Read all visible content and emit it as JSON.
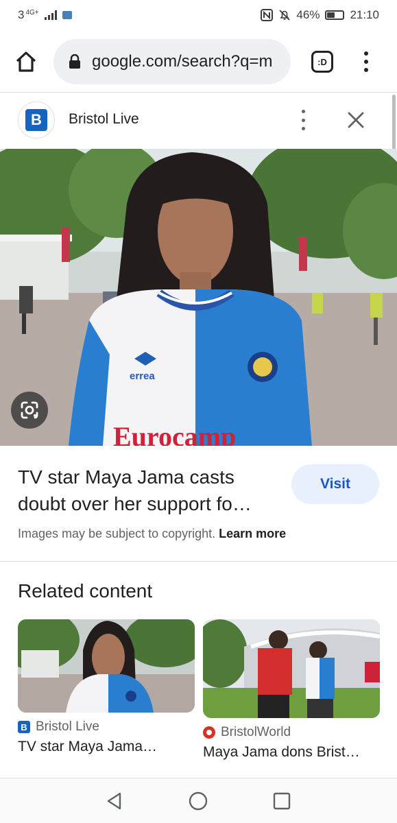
{
  "status_bar": {
    "network_label": "3",
    "network_type": "4G+",
    "battery_percent": "46%",
    "battery_level": 0.46,
    "time": "21:10",
    "icons": [
      "signal-icon",
      "app-notification-icon",
      "nfc-icon",
      "mute-icon",
      "battery-icon"
    ]
  },
  "browser": {
    "url": "google.com/search?q=m",
    "tabs_label": ":D",
    "icons": [
      "home-icon",
      "lock-icon",
      "tabs-icon",
      "more-vert-icon"
    ]
  },
  "source": {
    "logo_letter": "B",
    "name": "Bristol Live",
    "brand_color": "#1565c0",
    "icons": [
      "more-vert-icon",
      "close-icon"
    ]
  },
  "result": {
    "title": "TV star Maya Jama casts doubt over her support fo…",
    "visit_label": "Visit",
    "copyright_text": "Images may be subject to copyright.",
    "learn_more_label": "Learn more",
    "lens_icon": "google-lens-icon"
  },
  "related": {
    "heading": "Related content",
    "items": [
      {
        "source_logo": "B",
        "source": "Bristol Live",
        "title": "TV star Maya Jama…"
      },
      {
        "source": "BristolWorld",
        "title": "Maya Jama dons Brist…"
      }
    ]
  },
  "navigation": {
    "icons": [
      "back-triangle-icon",
      "home-circle-icon",
      "recents-square-icon"
    ]
  },
  "colors": {
    "accent_blue": "#1a56c8",
    "visit_bg": "#e8f0fe",
    "url_bar_bg": "#eef0f4"
  }
}
